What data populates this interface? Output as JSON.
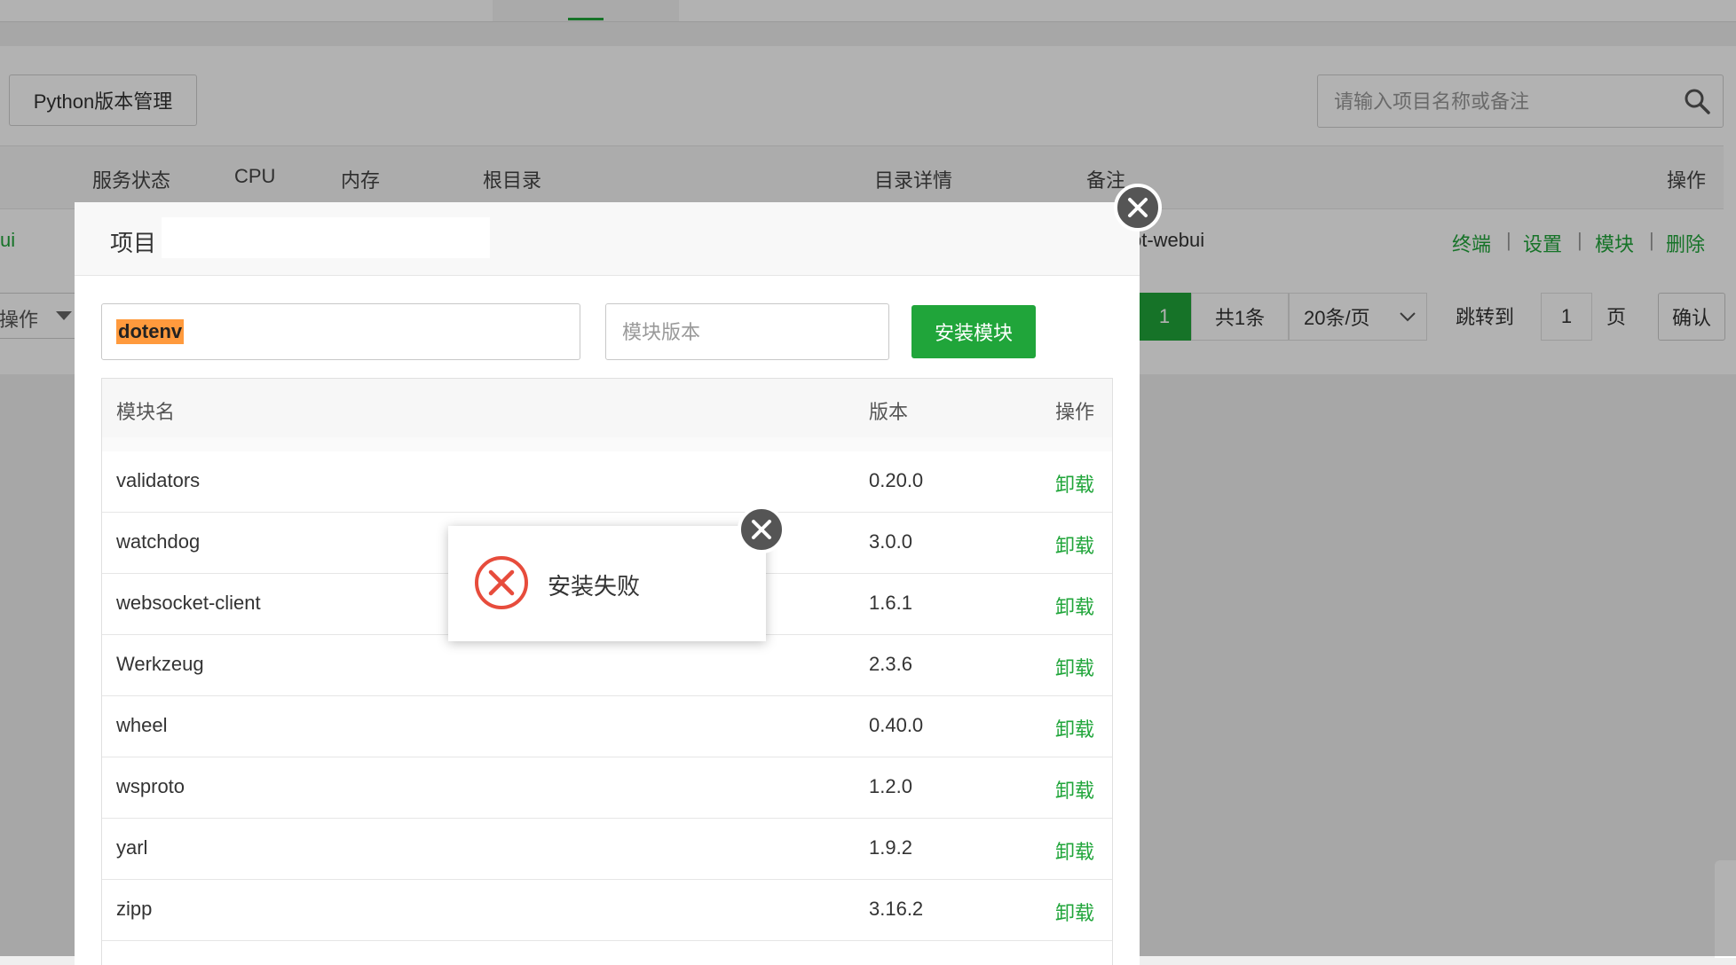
{
  "toolbar": {
    "python_version_btn": "Python版本管理",
    "search_placeholder": "请输入项目名称或备注"
  },
  "project_table": {
    "headers": {
      "status": "服务状态",
      "cpu": "CPU",
      "memory": "内存",
      "root": "根目录",
      "dir_details": "目录详情",
      "remark": "备注",
      "ops": "操作"
    },
    "row": {
      "name_fragment": "ui",
      "remark_fragment": "pt-webui",
      "actions": [
        "终端",
        "设置",
        "模块",
        "删除"
      ]
    }
  },
  "batch": {
    "label": "操作"
  },
  "pagination": {
    "current_page": "1",
    "total": "共1条",
    "per_page": "20条/页",
    "jump_label": "跳转到",
    "jump_value": "1",
    "page_unit": "页",
    "confirm": "确认"
  },
  "modal": {
    "title_prefix": "项目",
    "module_name_value": "dotenv",
    "module_version_placeholder": "模块版本",
    "install_button": "安装模块",
    "table_headers": {
      "name": "模块名",
      "version": "版本",
      "ops": "操作"
    },
    "modules": [
      {
        "name": "validators",
        "version": "0.20.0",
        "action": "卸载"
      },
      {
        "name": "watchdog",
        "version": "3.0.0",
        "action": "卸载"
      },
      {
        "name": "websocket-client",
        "version": "1.6.1",
        "action": "卸载"
      },
      {
        "name": "Werkzeug",
        "version": "2.3.6",
        "action": "卸载"
      },
      {
        "name": "wheel",
        "version": "0.40.0",
        "action": "卸载"
      },
      {
        "name": "wsproto",
        "version": "1.2.0",
        "action": "卸载"
      },
      {
        "name": "yarl",
        "version": "1.9.2",
        "action": "卸载"
      },
      {
        "name": "zipp",
        "version": "3.16.2",
        "action": "卸载"
      }
    ]
  },
  "toast": {
    "message": "安装失败"
  },
  "colors": {
    "brand_green": "#20a53a",
    "error_red": "#e74c3c",
    "highlight": "#ff9a3d"
  }
}
